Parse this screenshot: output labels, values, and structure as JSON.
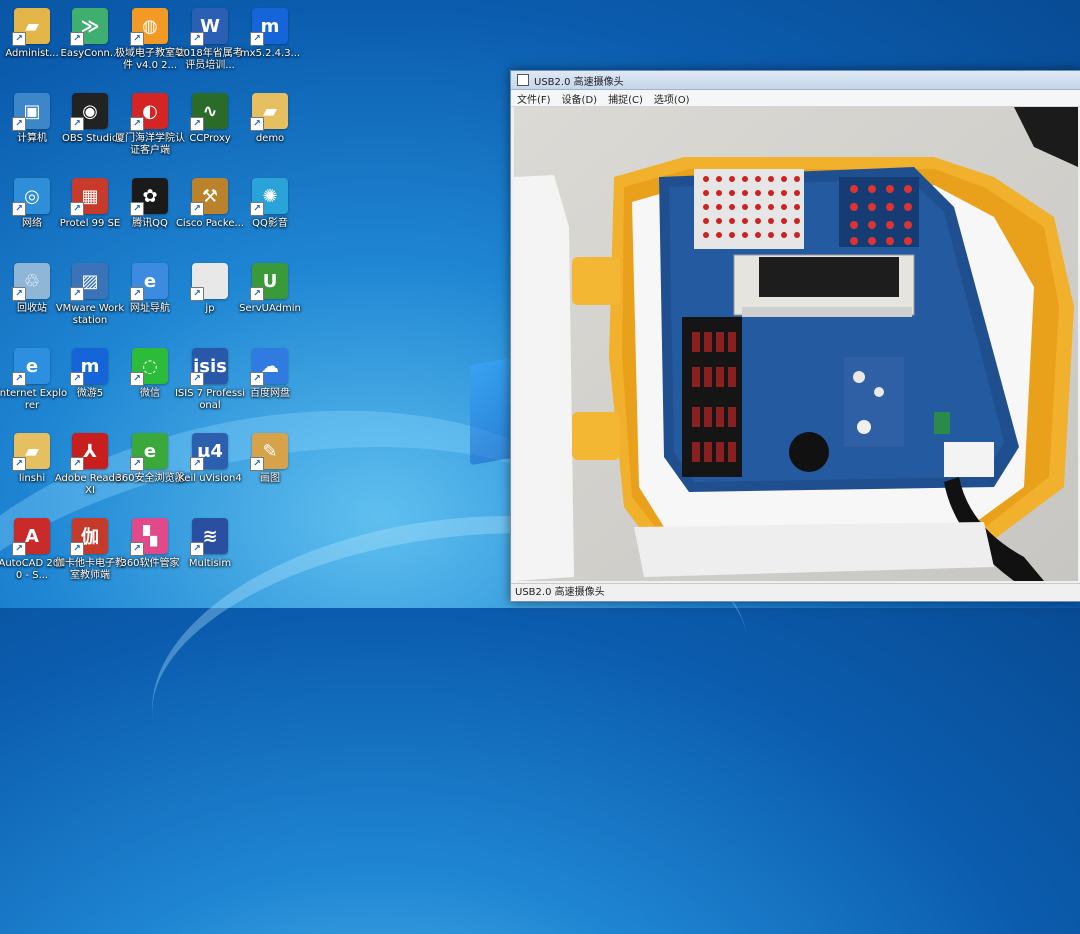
{
  "desktop": {
    "icons": [
      {
        "label": "Administ...",
        "icon": "user-folder-icon",
        "color": "#e3b64a",
        "glyph": "▰"
      },
      {
        "label": "EasyConn...",
        "icon": "easyconnect-icon",
        "color": "#3fae6f",
        "glyph": "≫"
      },
      {
        "label": "极域电子教室软件 v4.0 2...",
        "icon": "classroom-software-icon",
        "color": "#f29a25",
        "glyph": "◍"
      },
      {
        "label": "2018年省属考评员培训...",
        "icon": "word-document-icon",
        "color": "#2b5fb3",
        "glyph": "W"
      },
      {
        "label": "mx5.2.4.3...",
        "icon": "maxthon-icon",
        "color": "#1565d8",
        "glyph": "m"
      },
      {
        "label": "计算机",
        "icon": "computer-icon",
        "color": "#3d87c9",
        "glyph": "▣"
      },
      {
        "label": "OBS Studio",
        "icon": "obs-studio-icon",
        "color": "#222222",
        "glyph": "◉"
      },
      {
        "label": "厦门海洋学院认证客户端",
        "icon": "auth-client-icon",
        "color": "#d42424",
        "glyph": "◐"
      },
      {
        "label": "CCProxy",
        "icon": "ccproxy-icon",
        "color": "#2a6b2a",
        "glyph": "∿"
      },
      {
        "label": "demo",
        "icon": "folder-icon",
        "color": "#e6c060",
        "glyph": "▰"
      },
      {
        "label": "网络",
        "icon": "network-icon",
        "color": "#2f8ed8",
        "glyph": "◎"
      },
      {
        "label": "Protel 99 SE",
        "icon": "protel-icon",
        "color": "#c83b2b",
        "glyph": "▦"
      },
      {
        "label": "腾讯QQ",
        "icon": "qq-icon",
        "color": "#1a1a1a",
        "glyph": "✿"
      },
      {
        "label": "Cisco Packe...",
        "icon": "cisco-packet-tracer-icon",
        "color": "#b9822b",
        "glyph": "⚒"
      },
      {
        "label": "QQ影音",
        "icon": "qq-player-icon",
        "color": "#2aa3d8",
        "glyph": "✺"
      },
      {
        "label": "回收站",
        "icon": "recycle-bin-icon",
        "color": "#8fb6d6",
        "glyph": "♲"
      },
      {
        "label": "VMware Workstation",
        "icon": "vmware-icon",
        "color": "#3b73b9",
        "glyph": "▨"
      },
      {
        "label": "网址导航",
        "icon": "ie-navigation-icon",
        "color": "#3d8be0",
        "glyph": "e"
      },
      {
        "label": "jp",
        "icon": "blank-file-icon",
        "color": "#e8e8e8",
        "glyph": ""
      },
      {
        "label": "ServUAdmin",
        "icon": "servu-admin-icon",
        "color": "#3a9a3a",
        "glyph": "U"
      },
      {
        "label": "Internet Explorer",
        "icon": "internet-explorer-icon",
        "color": "#2c8fe0",
        "glyph": "e"
      },
      {
        "label": "微游5",
        "icon": "maxthon-5-icon",
        "color": "#1565d8",
        "glyph": "m"
      },
      {
        "label": "微信",
        "icon": "wechat-icon",
        "color": "#2dbb3a",
        "glyph": "◌"
      },
      {
        "label": "ISIS 7 Professional",
        "icon": "isis-icon",
        "color": "#2a58a8",
        "glyph": "isis"
      },
      {
        "label": "百度网盘",
        "icon": "baidu-netdisk-icon",
        "color": "#2f7be0",
        "glyph": "☁"
      },
      {
        "label": "linshi",
        "icon": "folder-icon",
        "color": "#e6c060",
        "glyph": "▰"
      },
      {
        "label": "Adobe Reader XI",
        "icon": "adobe-reader-icon",
        "color": "#c81e1e",
        "glyph": "⅄"
      },
      {
        "label": "360安全浏览器",
        "icon": "360-browser-icon",
        "color": "#3aa83a",
        "glyph": "e"
      },
      {
        "label": "Keil uVision4",
        "icon": "keil-icon",
        "color": "#2c5fae",
        "glyph": "μ4"
      },
      {
        "label": "画图",
        "icon": "paint-icon",
        "color": "#d6a34a",
        "glyph": "✎"
      },
      {
        "label": "AutoCAD 2010 - S...",
        "icon": "autocad-icon",
        "color": "#c92a2a",
        "glyph": "A"
      },
      {
        "label": "伽卡他卡电子教室教师端",
        "icon": "jiaka-classroom-icon",
        "color": "#c43b2b",
        "glyph": "伽"
      },
      {
        "label": "360软件管家",
        "icon": "360-software-manager-icon",
        "color": "#e04a8a",
        "glyph": "▚"
      },
      {
        "label": "Multisim",
        "icon": "multisim-icon",
        "color": "#2b4fa0",
        "glyph": "≋"
      }
    ]
  },
  "camera_window": {
    "title": "USB2.0 高速摄像头",
    "menu": [
      "文件(F)",
      "设备(D)",
      "捕捉(C)",
      "选项(O)"
    ],
    "status": "USB2.0 高速摄像头"
  }
}
